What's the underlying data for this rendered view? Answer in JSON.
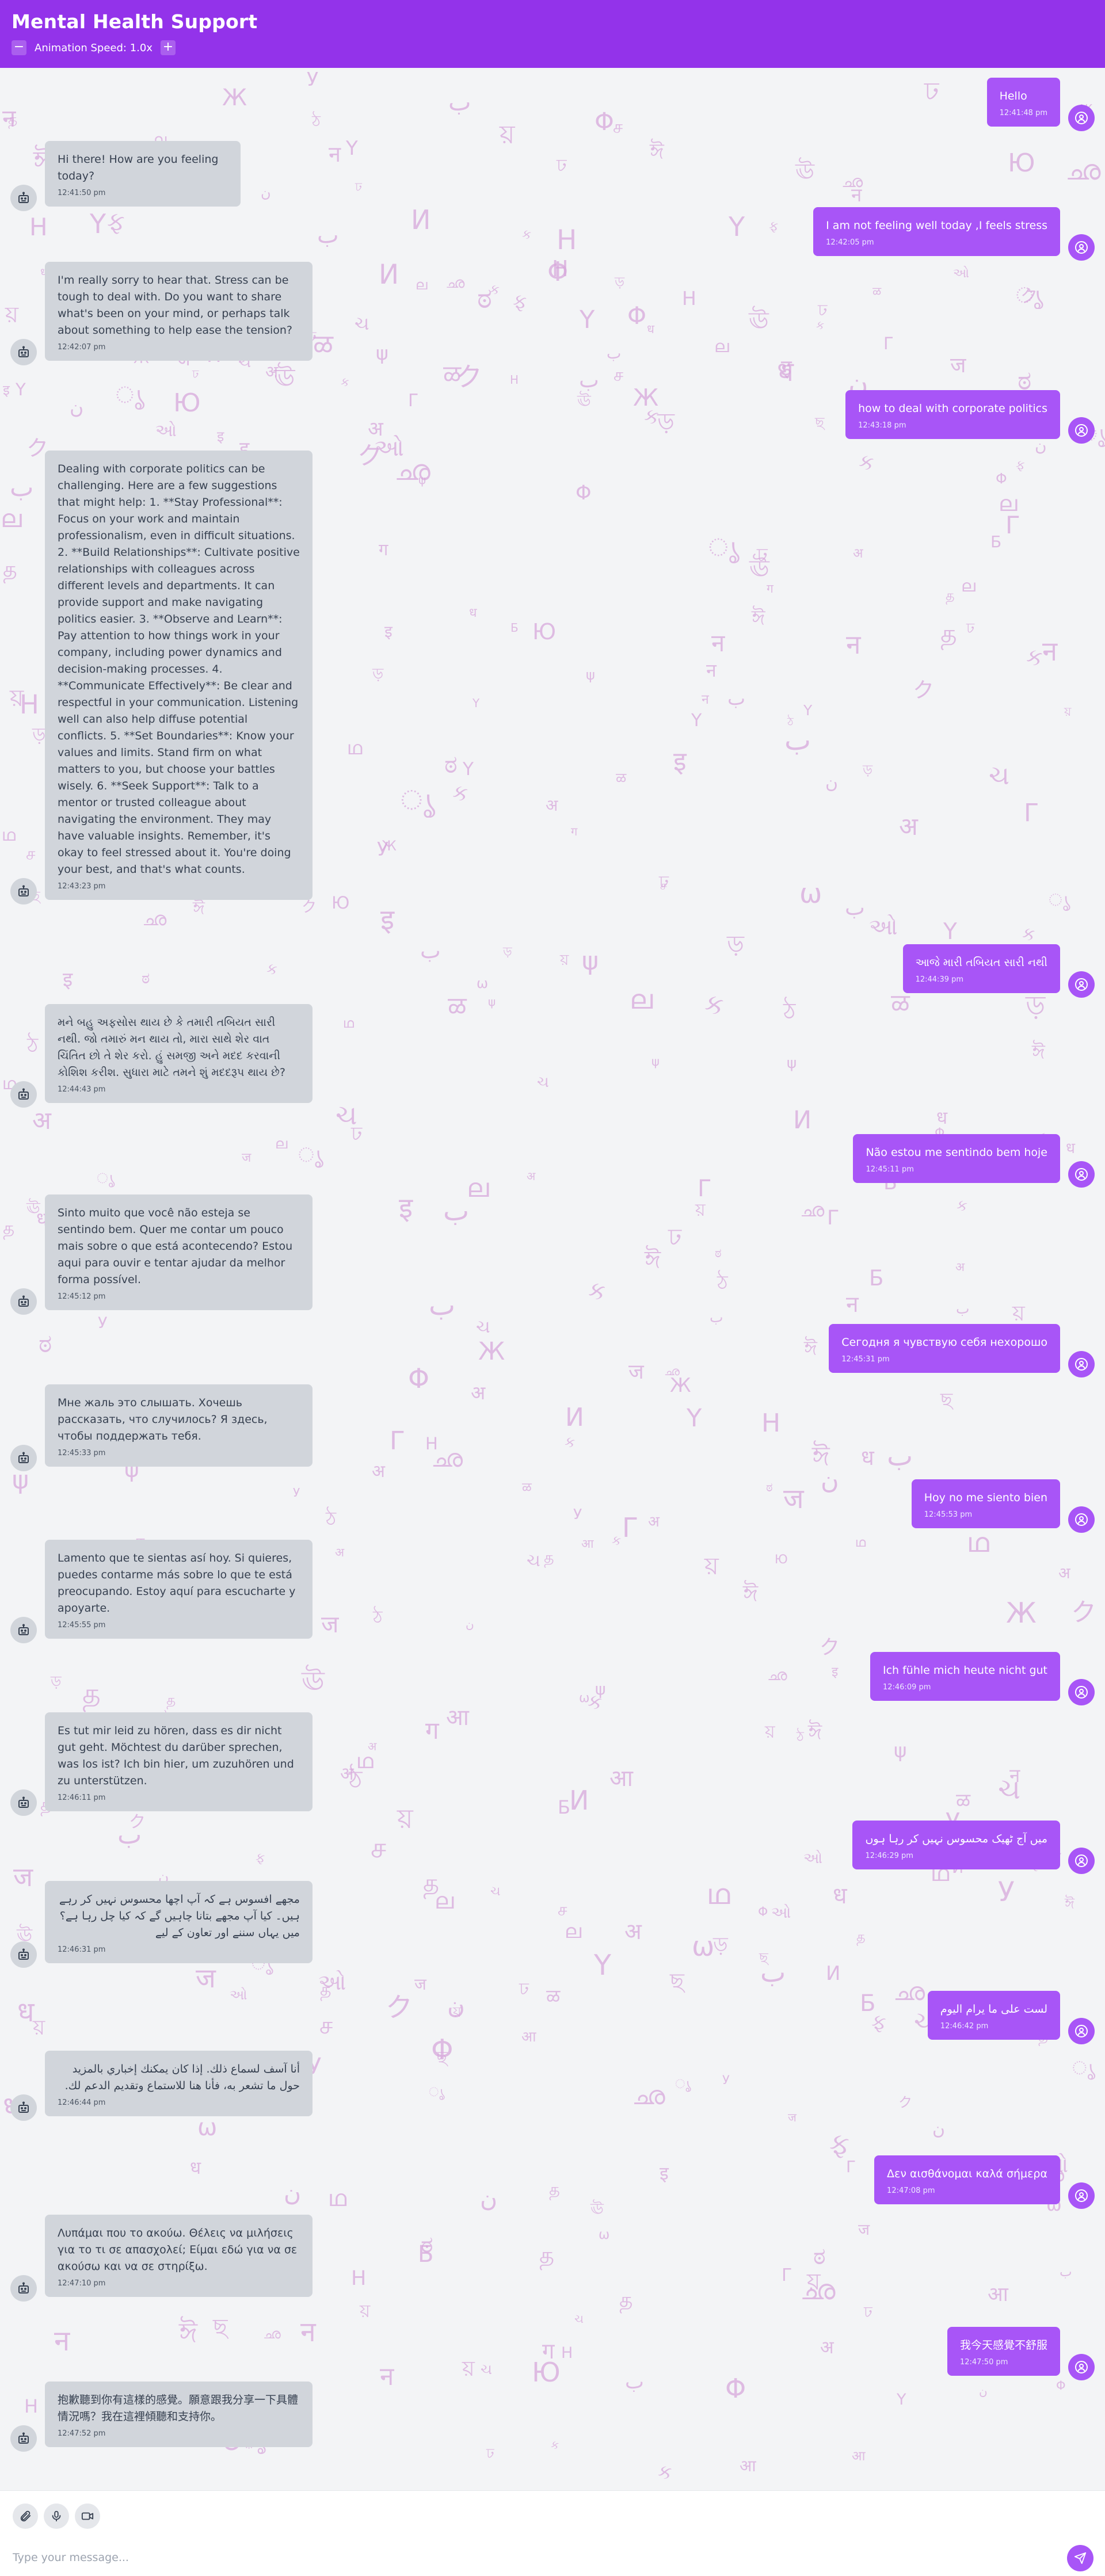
{
  "header": {
    "title": "Mental Health Support",
    "speed_label": "Animation Speed: 1.0x",
    "minus": "−",
    "plus": "+"
  },
  "messages": [
    {
      "role": "user",
      "text": "Hello",
      "time": "12:41:48 pm"
    },
    {
      "role": "bot",
      "text": "Hi there! How are you feeling today?",
      "time": "12:41:50 pm"
    },
    {
      "role": "user",
      "text": "I am not feeling well today ,I feels stress",
      "time": "12:42:05 pm"
    },
    {
      "role": "bot",
      "text": "I'm really sorry to hear that. Stress can be tough to deal with. Do you want to share what's been on your mind, or perhaps talk about something to help ease the tension?",
      "time": "12:42:07 pm"
    },
    {
      "role": "user",
      "text": "how to deal with corporate politics",
      "time": "12:43:18 pm"
    },
    {
      "role": "bot",
      "text": "Dealing with corporate politics can be challenging. Here are a few suggestions that might help: 1. **Stay Professional**: Focus on your work and maintain professionalism, even in difficult situations. 2. **Build Relationships**: Cultivate positive relationships with colleagues across different levels and departments. It can provide support and make navigating politics easier. 3. **Observe and Learn**: Pay attention to how things work in your company, including power dynamics and decision-making processes. 4. **Communicate Effectively**: Be clear and respectful in your communication. Listening well can also help diffuse potential conflicts. 5. **Set Boundaries**: Know your values and limits. Stand firm on what matters to you, but choose your battles wisely. 6. **Seek Support**: Talk to a mentor or trusted colleague about navigating the environment. They may have valuable insights. Remember, it's okay to feel stressed about it. You're doing your best, and that's what counts.",
      "time": "12:43:23 pm"
    },
    {
      "role": "user",
      "text": "આજે મારી તબિયત સારી નથી",
      "time": "12:44:39 pm"
    },
    {
      "role": "bot",
      "text": "મને બહુ અફસોસ થાય છે કે તમારી તબિયત સારી નથી. જો તમારું મન થાય તો, મારા સાથે શેર વાત ચિંતિત છો તે શેર કરો. હું સમજી અને મદદ કરવાની કોશિશ કરીશ. સુધારા માટે તમને શું મદદરૂપ થાય છે?",
      "time": "12:44:43 pm"
    },
    {
      "role": "user",
      "text": "Não estou me sentindo bem hoje",
      "time": "12:45:11 pm"
    },
    {
      "role": "bot",
      "text": "Sinto muito que você não esteja se sentindo bem. Quer me contar um pouco mais sobre o que está acontecendo? Estou aqui para ouvir e tentar ajudar da melhor forma possível.",
      "time": "12:45:12 pm"
    },
    {
      "role": "user",
      "text": "Сегодня я чувствую себя нехорошо",
      "time": "12:45:31 pm"
    },
    {
      "role": "bot",
      "text": "Мне жаль это слышать. Хочешь рассказать, что случилось? Я здесь, чтобы поддержать тебя.",
      "time": "12:45:33 pm"
    },
    {
      "role": "user",
      "text": "Hoy no me siento bien",
      "time": "12:45:53 pm"
    },
    {
      "role": "bot",
      "text": "Lamento que te sientas así hoy. Si quieres, puedes contarme más sobre lo que te está preocupando. Estoy aquí para escucharte y apoyarte.",
      "time": "12:45:55 pm"
    },
    {
      "role": "user",
      "text": "Ich fühle mich heute nicht gut",
      "time": "12:46:09 pm"
    },
    {
      "role": "bot",
      "text": "Es tut mir leid zu hören, dass es dir nicht gut geht. Möchtest du darüber sprechen, was los ist? Ich bin hier, um zuzuhören und zu unterstützen.",
      "time": "12:46:11 pm"
    },
    {
      "role": "user",
      "text": "میں آج ٹھیک محسوس نہیں کر رہا ہوں",
      "time": "12:46:29 pm",
      "rtl": true
    },
    {
      "role": "bot",
      "text": "مجھے افسوس ہے کہ آپ اچھا محسوس نہیں کر رہے ہیں۔ کیا آپ مجھے بتانا چاہیں گے کہ کیا چل رہا ہے؟ میں یہاں سننے اور تعاون کے لیے",
      "time": "12:46:31 pm",
      "rtl": true
    },
    {
      "role": "user",
      "text": "لست على ما يرام اليوم",
      "time": "12:46:42 pm",
      "rtl": true
    },
    {
      "role": "bot",
      "text": "أنا آسف لسماع ذلك. إذا كان يمكنك إخباري بالمزيد حول ما تشعر به، فأنا هنا للاستماع وتقديم الدعم لك.",
      "time": "12:46:44 pm",
      "rtl": true
    },
    {
      "role": "user",
      "text": "Δεν αισθάνομαι καλά σήμερα",
      "time": "12:47:08 pm"
    },
    {
      "role": "bot",
      "text": "Λυπάμαι που το ακούω. Θέλεις να μιλήσεις για το τι σε απασχολεί; Είμαι εδώ για να σε ακούσω και να σε στηρίξω.",
      "time": "12:47:10 pm"
    },
    {
      "role": "user",
      "text": "我今天感覺不舒服",
      "time": "12:47:50 pm"
    },
    {
      "role": "bot",
      "text": "抱歉聽到你有這樣的感覺。願意跟我分享一下具體情況嗎？我在這裡傾聽和支持你。",
      "time": "12:47:52 pm"
    }
  ],
  "input": {
    "placeholder": "Type your message..."
  },
  "icons": {
    "user_avatar": "user-icon",
    "bot_avatar": "robot-icon",
    "attach": "paperclip-icon",
    "mic": "microphone-icon",
    "video": "video-camera-icon",
    "send": "send-icon"
  },
  "colors": {
    "header": "#9333ea",
    "user_bubble": "#a855f7",
    "bot_bubble": "#d1d5db",
    "background": "#f3f4f6"
  }
}
